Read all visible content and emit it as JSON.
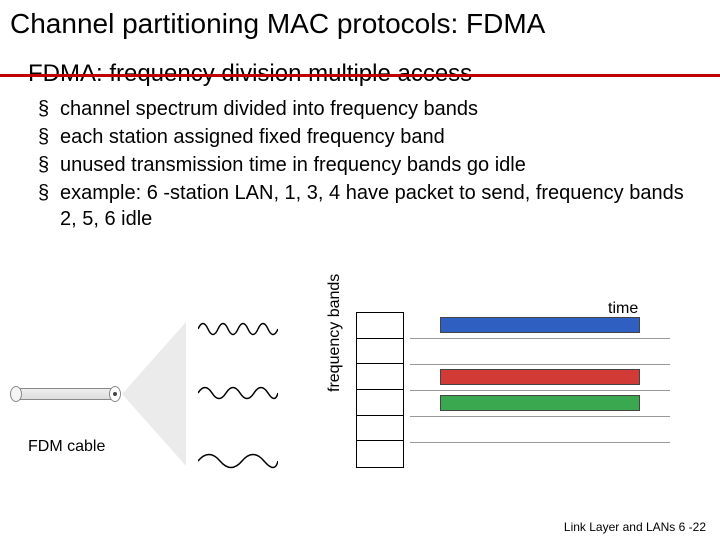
{
  "title": "Channel partitioning MAC protocols: FDMA",
  "subtitle": "FDMA: frequency division multiple access",
  "bullets": [
    "channel spectrum divided into frequency bands",
    "each station assigned fixed frequency band",
    "unused transmission time in frequency bands go idle",
    "example: 6 -station LAN, 1, 3, 4 have packet to send, frequency bands 2, 5, 6 idle"
  ],
  "diagram": {
    "cable_label": "FDM cable",
    "yaxis_label": "frequency bands",
    "time_label": "time"
  },
  "chart_data": {
    "type": "table",
    "title": "FDMA channel usage over time",
    "num_bands": 6,
    "stations_sending": [
      1,
      3,
      4
    ],
    "bands_idle": [
      2,
      5,
      6
    ],
    "band_signals": [
      {
        "band": 1,
        "frequency": "high",
        "active": true,
        "color": "#2e5fc1"
      },
      {
        "band": 2,
        "frequency": null,
        "active": false,
        "color": null
      },
      {
        "band": 3,
        "frequency": "medium",
        "active": true,
        "color": "#d23a36"
      },
      {
        "band": 4,
        "frequency": "low",
        "active": true,
        "color": "#3aa84f"
      },
      {
        "band": 5,
        "frequency": null,
        "active": false,
        "color": null
      },
      {
        "band": 6,
        "frequency": null,
        "active": false,
        "color": null
      }
    ]
  },
  "footer": "Link Layer and LANs  6 -22"
}
